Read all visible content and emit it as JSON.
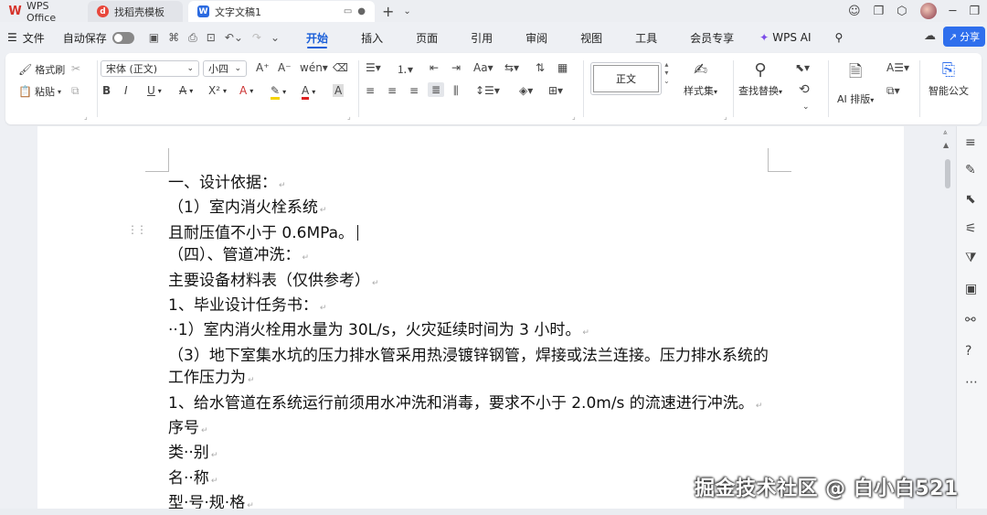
{
  "titlebar": {
    "tabs": [
      {
        "label": "WPS Office"
      },
      {
        "label": "找稻壳模板"
      },
      {
        "label": "文字文稿1"
      }
    ],
    "new_tab": "+"
  },
  "menubar": {
    "file": "文件",
    "autosave": "自动保存",
    "tabs": [
      "开始",
      "插入",
      "页面",
      "引用",
      "审阅",
      "视图",
      "工具",
      "会员专享",
      "WPS AI"
    ],
    "active_tab": "开始",
    "share": "分享"
  },
  "ribbon": {
    "format_painter": "格式刷",
    "paste": "粘贴",
    "font_name": "宋体 (正文)",
    "font_size": "小四",
    "style_preview": "正文",
    "style_set": "样式集",
    "find_replace": "查找替换",
    "ai_layout": "AI 排版",
    "smart_doc": "智能公文"
  },
  "document": {
    "paragraphs": [
      "一、设计依据：",
      "（1）室内消火栓系统",
      "且耐压值不小于 0.6MPa。",
      "（四）、管道冲洗：",
      "主要设备材料表（仅供参考）",
      "1、毕业设计任务书：",
      "··1）室内消火栓用水量为 30L/s，火灾延续时间为 3 小时。",
      "（3）地下室集水坑的压力排水管采用热浸镀锌钢管，焊接或法兰连接。压力排水系统的工作压力为",
      "1、给水管道在系统运行前须用水冲洗和消毒，要求不小于 2.0m/s 的流速进行冲洗。",
      "序号",
      "类··别",
      "名··称",
      "型·号·规·格"
    ]
  },
  "watermark": "掘金技术社区 @ 白小白521"
}
